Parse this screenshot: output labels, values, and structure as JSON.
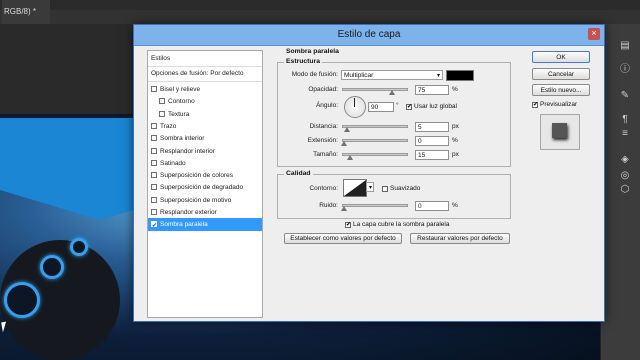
{
  "workspace": {
    "doc_tab": "RGB/8) *"
  },
  "dialog": {
    "title": "Estilo de capa",
    "close_label": "×",
    "styles_header": "Estilos",
    "blend_options": "Opciones de fusión: Por defecto",
    "effects": [
      {
        "label": "Bisel y relieve",
        "checked": false,
        "indent": 0
      },
      {
        "label": "Contorno",
        "checked": false,
        "indent": 1
      },
      {
        "label": "Textura",
        "checked": false,
        "indent": 1
      },
      {
        "label": "Trazo",
        "checked": false,
        "indent": 0
      },
      {
        "label": "Sombra interior",
        "checked": false,
        "indent": 0
      },
      {
        "label": "Resplandor interior",
        "checked": false,
        "indent": 0
      },
      {
        "label": "Satinado",
        "checked": false,
        "indent": 0
      },
      {
        "label": "Superposición de colores",
        "checked": false,
        "indent": 0
      },
      {
        "label": "Superposición de degradado",
        "checked": false,
        "indent": 0
      },
      {
        "label": "Superposición de motivo",
        "checked": false,
        "indent": 0
      },
      {
        "label": "Resplandor exterior",
        "checked": false,
        "indent": 0
      },
      {
        "label": "Sombra paralela",
        "checked": true,
        "indent": 0,
        "selected": true
      }
    ],
    "section_title": "Sombra paralela",
    "structure": {
      "legend": "Estructura",
      "blend_mode_label": "Modo de fusión:",
      "blend_mode_value": "Multiplicar",
      "shadow_color": "#000000",
      "opacity_label": "Opacidad:",
      "opacity_value": "75",
      "opacity_unit": "%",
      "angle_label": "Ángulo:",
      "angle_value": "90",
      "angle_unit": "°",
      "global_light_label": "Usar luz global",
      "global_light_checked": true,
      "distance_label": "Distancia:",
      "distance_value": "5",
      "distance_unit": "px",
      "spread_label": "Extensión:",
      "spread_value": "0",
      "spread_unit": "%",
      "size_label": "Tamaño:",
      "size_value": "15",
      "size_unit": "px"
    },
    "quality": {
      "legend": "Calidad",
      "contour_label": "Contorno:",
      "antialias_label": "Suavizado",
      "antialias_checked": false,
      "noise_label": "Ruido:",
      "noise_value": "0",
      "noise_unit": "%"
    },
    "knockout_label": "La capa cubre la sombra paralela",
    "knockout_checked": true,
    "make_default_label": "Establecer como valores por defecto",
    "reset_default_label": "Restaurar valores por defecto",
    "ok_label": "OK",
    "cancel_label": "Cancelar",
    "new_style_label": "Estilo nuevo...",
    "preview_label": "Previsualizar",
    "preview_checked": true
  }
}
